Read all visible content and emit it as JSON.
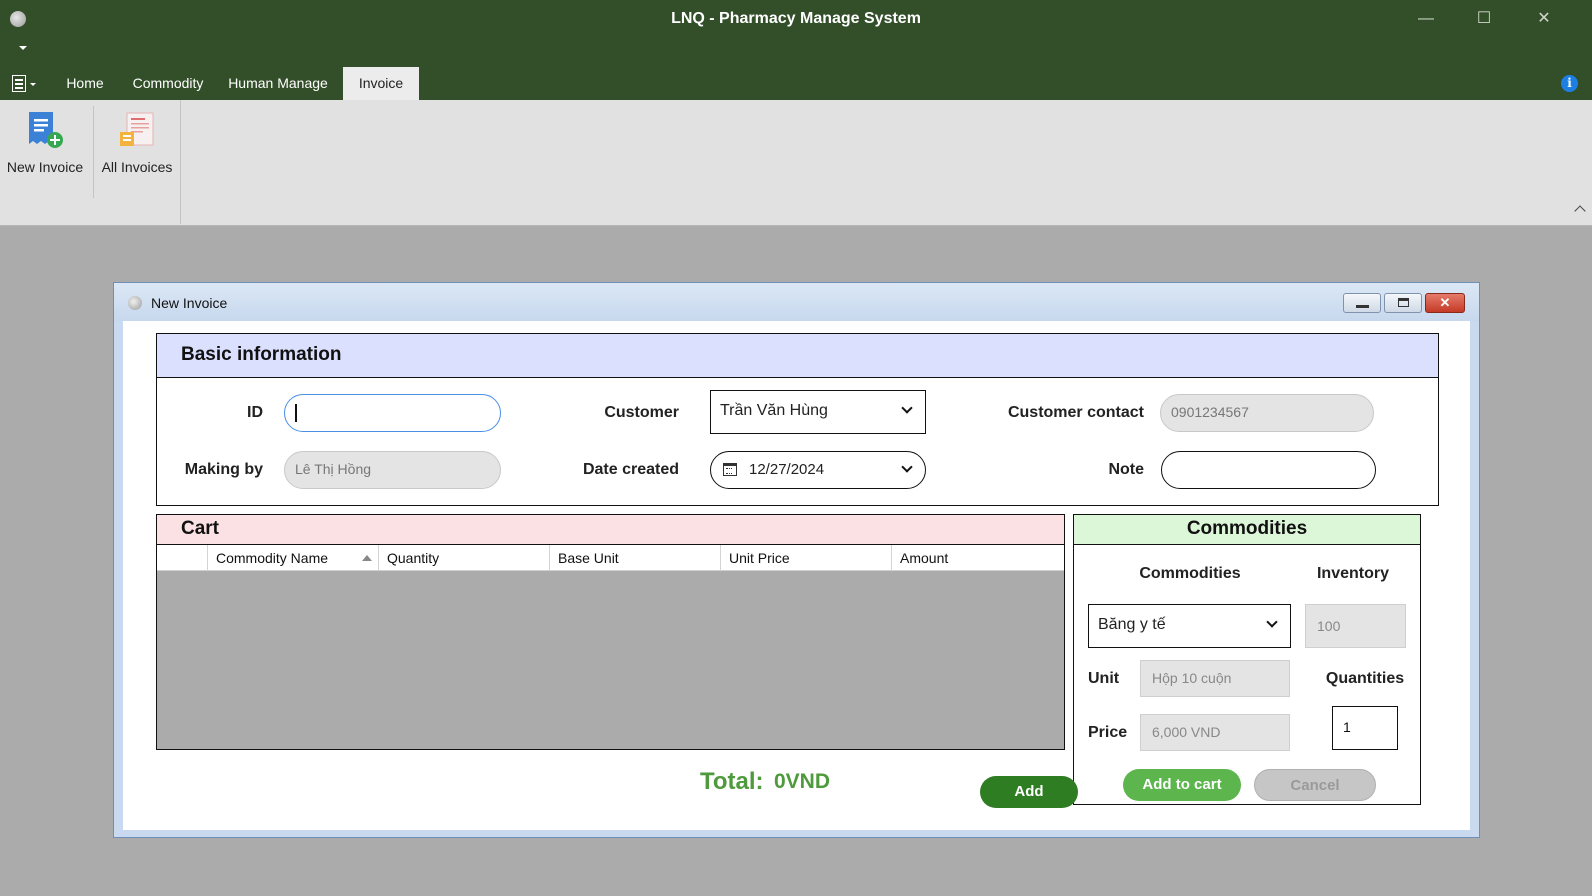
{
  "app": {
    "title": "LNQ - Pharmacy Manage System",
    "window_controls": {
      "minimize": "—",
      "maximize": "☐",
      "close": "✕"
    }
  },
  "ribbon": {
    "tabs": [
      {
        "label": "Home",
        "active": false
      },
      {
        "label": "Commodity",
        "active": false
      },
      {
        "label": "Human Manage",
        "active": false
      },
      {
        "label": "Invoice",
        "active": true
      }
    ],
    "buttons": [
      {
        "label": "New Invoice",
        "icon": "new-invoice-icon"
      },
      {
        "label": "All Invoices",
        "icon": "all-invoices-icon"
      }
    ],
    "info_icon": "i"
  },
  "child_window": {
    "title": "New Invoice",
    "close_glyph": "✕"
  },
  "basic_info": {
    "title": "Basic information",
    "id_label": "ID",
    "id_value": "",
    "making_by_label": "Making by",
    "making_by_value": "Lê Thị Hồng",
    "customer_label": "Customer",
    "customer_value": "Trần Văn Hùng",
    "date_label": "Date created",
    "date_value": "12/27/2024",
    "contact_label": "Customer contact",
    "contact_value": "0901234567",
    "note_label": "Note",
    "note_value": ""
  },
  "cart": {
    "title": "Cart",
    "columns": [
      "",
      "Commodity Name",
      "Quantity",
      "Base Unit",
      "Unit Price",
      "Amount"
    ],
    "rows": []
  },
  "totals": {
    "label": "Total:",
    "value": "0VND",
    "add_label": "Add"
  },
  "commodities": {
    "title": "Commodities",
    "commodity_label": "Commodities",
    "commodity_value": "Băng y tế",
    "inventory_label": "Inventory",
    "inventory_value": "100",
    "unit_label": "Unit",
    "unit_value": "Hộp 10 cuộn",
    "quantities_label": "Quantities",
    "quantities_value": "1",
    "price_label": "Price",
    "price_value": "6,000 VND",
    "add_to_cart_label": "Add to cart",
    "cancel_label": "Cancel"
  },
  "colors": {
    "titlebar": "#334f2a",
    "basic_header": "#dbe0ff",
    "cart_header": "#fbe1e4",
    "commodities_header": "#dcf7d8",
    "accent_green": "#2e7d22",
    "total_green": "#4e9a3c"
  }
}
